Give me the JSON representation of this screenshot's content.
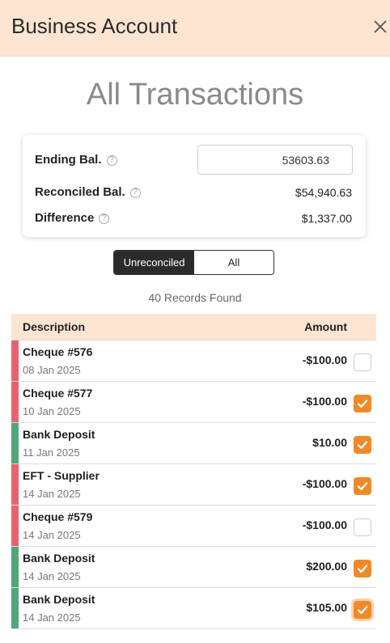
{
  "header": {
    "title": "Business Account"
  },
  "page": {
    "title": "All Transactions"
  },
  "summary": {
    "ending_label": "Ending Bal.",
    "ending_value": "53603.63",
    "reconciled_label": "Reconciled Bal.",
    "reconciled_value": "$54,940.63",
    "difference_label": "Difference",
    "difference_value": "$1,337.00"
  },
  "filter": {
    "options": [
      "Unreconciled",
      "All"
    ],
    "selected": "Unreconciled"
  },
  "records_found": "40 Records Found",
  "table": {
    "columns": [
      "Description",
      "Amount"
    ],
    "rows": [
      {
        "description": "Cheque #576",
        "date": "08 Jan 2025",
        "amount": "-$100.00",
        "type": "debit",
        "checked": false
      },
      {
        "description": "Cheque #577",
        "date": "10 Jan 2025",
        "amount": "-$100.00",
        "type": "debit",
        "checked": true
      },
      {
        "description": "Bank Deposit",
        "date": "11 Jan 2025",
        "amount": "$10.00",
        "type": "credit",
        "checked": true
      },
      {
        "description": "EFT - Supplier",
        "date": "14 Jan 2025",
        "amount": "-$100.00",
        "type": "debit",
        "checked": true
      },
      {
        "description": "Cheque #579",
        "date": "14 Jan 2025",
        "amount": "-$100.00",
        "type": "debit",
        "checked": false
      },
      {
        "description": "Bank Deposit",
        "date": "14 Jan 2025",
        "amount": "$200.00",
        "type": "credit",
        "checked": true
      },
      {
        "description": "Bank Deposit",
        "date": "14 Jan 2025",
        "amount": "$105.00",
        "type": "credit",
        "checked": true,
        "focused": true
      }
    ]
  },
  "colors": {
    "debit": "#e8636f",
    "credit": "#4fa77b",
    "accent": "#ef8a2a",
    "header_bg": "#fde5d2"
  },
  "icons": {
    "close": "close-icon",
    "help": "help-icon",
    "check": "check-icon"
  }
}
